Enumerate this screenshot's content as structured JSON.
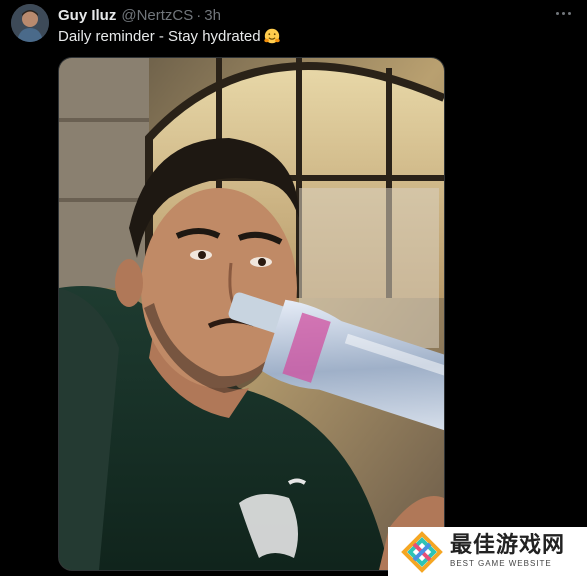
{
  "tweet": {
    "author_name": "Guy Iluz",
    "handle": "@NertzCS",
    "separator": "·",
    "timestamp": "3h",
    "text": "Daily reminder - Stay hydrated",
    "emoji_icon": "hugging-face-icon",
    "more_icon": "more-options-icon"
  },
  "media": {
    "alt": "Man drinking from a glass water bottle in front of an arched window"
  },
  "watermark": {
    "title": "最佳游戏网",
    "subtitle": "BEST GAME WEBSITE"
  },
  "colors": {
    "background": "#000000",
    "text_primary": "#e7e9ea",
    "text_secondary": "#71767b",
    "border": "#2f3336"
  }
}
